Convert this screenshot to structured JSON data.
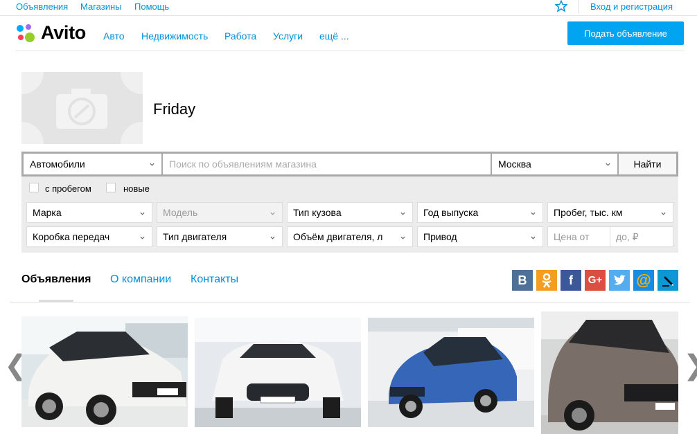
{
  "topbar": {
    "links": [
      "Объявления",
      "Магазины",
      "Помощь"
    ],
    "login": "Вход и регистрация"
  },
  "header": {
    "logo_text": "Avito",
    "nav": [
      "Авто",
      "Недвижимость",
      "Работа",
      "Услуги",
      "ещё ..."
    ],
    "post_button": "Подать объявление"
  },
  "shop": {
    "name": "Friday"
  },
  "search": {
    "category": "Автомобили",
    "placeholder": "Поиск по объявлениям магазина",
    "city": "Москва",
    "button": "Найти"
  },
  "filters": {
    "checkboxes": [
      "с пробегом",
      "новые"
    ],
    "row1": [
      "Марка",
      "Модель",
      "Тип кузова",
      "Год выпуска",
      "Пробег, тыс. км"
    ],
    "row2": [
      "Коробка передач",
      "Тип двигателя",
      "Объём двигателя, л",
      "Привод"
    ],
    "price_from": "Цена от",
    "price_to": "до, ₽"
  },
  "tabs": [
    "Объявления",
    "О компании",
    "Контакты"
  ],
  "social": [
    "В",
    "ОК",
    "f",
    "G+",
    "twitter",
    "@",
    "ЖЖ"
  ],
  "colors": {
    "accent": "#0091d9",
    "button": "#00a4f0",
    "vk": "#4d7198",
    "ok": "#f59c23",
    "fb": "#3b5998",
    "gplus": "#dc4e41",
    "twitter": "#55acee",
    "mail": "#168de2",
    "lj": "#0e97d5"
  },
  "cars": [
    "car-white-renault",
    "car-white-hyundai",
    "car-blue-chevrolet",
    "car-brown-kia"
  ]
}
